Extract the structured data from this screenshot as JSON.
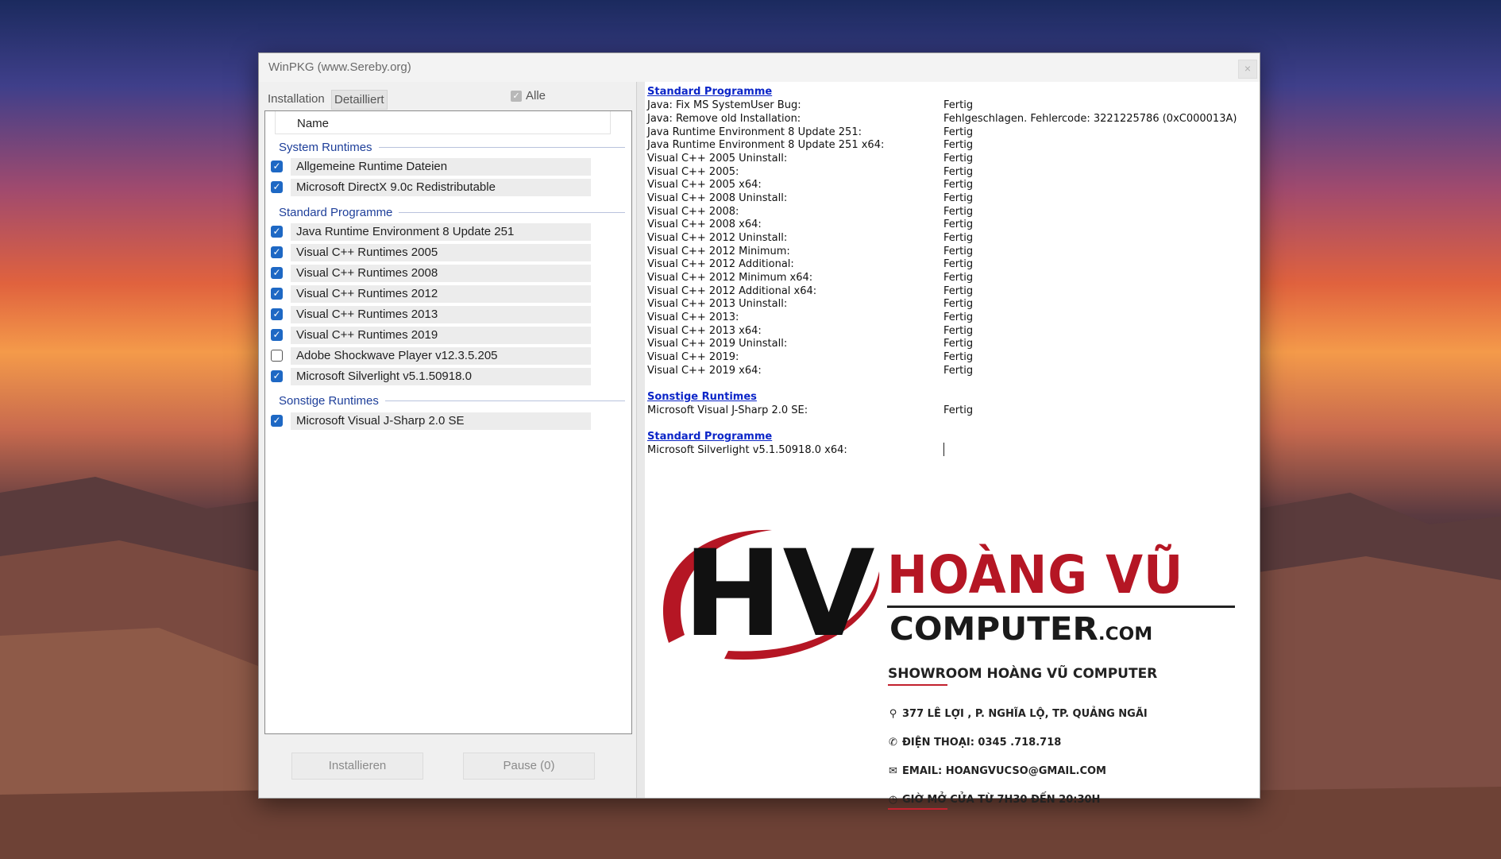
{
  "window": {
    "title": "WinPKG (www.Sereby.org)",
    "close_label": "×"
  },
  "tabs": {
    "installation": "Installation",
    "detailliert": "Detailliert"
  },
  "alle": {
    "label": "Alle",
    "checked": true
  },
  "list": {
    "column_header": "Name",
    "groups": [
      {
        "label": "System Runtimes",
        "items": [
          {
            "label": "Allgemeine Runtime Dateien",
            "checked": true
          },
          {
            "label": "Microsoft DirectX 9.0c Redistributable",
            "checked": true
          }
        ]
      },
      {
        "label": "Standard Programme",
        "items": [
          {
            "label": "Java Runtime Environment 8 Update 251",
            "checked": true
          },
          {
            "label": "Visual C++ Runtimes 2005",
            "checked": true
          },
          {
            "label": "Visual C++ Runtimes 2008",
            "checked": true
          },
          {
            "label": "Visual C++ Runtimes 2012",
            "checked": true
          },
          {
            "label": "Visual C++ Runtimes 2013",
            "checked": true
          },
          {
            "label": "Visual C++ Runtimes 2019",
            "checked": true
          },
          {
            "label": "Adobe Shockwave Player v12.3.5.205",
            "checked": false
          },
          {
            "label": "Microsoft Silverlight v5.1.50918.0",
            "checked": true
          }
        ]
      },
      {
        "label": "Sonstige Runtimes",
        "items": [
          {
            "label": "Microsoft Visual J-Sharp 2.0 SE",
            "checked": true
          }
        ]
      }
    ]
  },
  "buttons": {
    "install": "Installieren",
    "pause": "Pause (0)"
  },
  "log": {
    "sections": [
      {
        "heading": "Standard Programme",
        "entries": [
          {
            "name": "Java: Fix MS SystemUser Bug:",
            "status": "Fertig"
          },
          {
            "name": "Java: Remove old Installation:",
            "status": "Fehlgeschlagen. Fehlercode: 3221225786 (0xC000013A)"
          },
          {
            "name": "Java Runtime Environment 8 Update 251:",
            "status": "Fertig"
          },
          {
            "name": "Java Runtime Environment 8 Update 251 x64:",
            "status": "Fertig"
          },
          {
            "name": "Visual C++ 2005 Uninstall:",
            "status": "Fertig"
          },
          {
            "name": "Visual C++ 2005:",
            "status": "Fertig"
          },
          {
            "name": "Visual C++ 2005 x64:",
            "status": "Fertig"
          },
          {
            "name": "Visual C++ 2008 Uninstall:",
            "status": "Fertig"
          },
          {
            "name": "Visual C++ 2008:",
            "status": "Fertig"
          },
          {
            "name": "Visual C++ 2008 x64:",
            "status": "Fertig"
          },
          {
            "name": "Visual C++ 2012 Uninstall:",
            "status": "Fertig"
          },
          {
            "name": "Visual C++ 2012 Minimum:",
            "status": "Fertig"
          },
          {
            "name": "Visual C++ 2012 Additional:",
            "status": "Fertig"
          },
          {
            "name": "Visual C++ 2012 Minimum x64:",
            "status": "Fertig"
          },
          {
            "name": "Visual C++ 2012 Additional x64:",
            "status": "Fertig"
          },
          {
            "name": "Visual C++ 2013 Uninstall:",
            "status": "Fertig"
          },
          {
            "name": "Visual C++ 2013:",
            "status": "Fertig"
          },
          {
            "name": "Visual C++ 2013 x64:",
            "status": "Fertig"
          },
          {
            "name": "Visual C++ 2019 Uninstall:",
            "status": "Fertig"
          },
          {
            "name": "Visual C++ 2019:",
            "status": "Fertig"
          },
          {
            "name": "Visual C++ 2019 x64:",
            "status": "Fertig"
          }
        ]
      },
      {
        "heading": "Sonstige Runtimes",
        "entries": [
          {
            "name": "Microsoft Visual J-Sharp 2.0 SE:",
            "status": "Fertig"
          }
        ]
      },
      {
        "heading": "Standard Programme",
        "entries": [
          {
            "name": "Microsoft Silverlight v5.1.50918.0 x64:",
            "status": ""
          }
        ]
      }
    ]
  },
  "watermark": {
    "logo_letters": "HV",
    "name": "HOÀNG VŨ",
    "domain_main": "COMPUTER",
    "domain_suffix": ".COM",
    "showroom": "SHOWROOM HOÀNG VŨ COMPUTER",
    "address": "377 LÊ LỢI , P. NGHĨA LỘ, TP. QUẢNG NGÃI",
    "phone": "ĐIỆN THOẠI: 0345 .718.718",
    "email": "EMAIL: HOANGVUCSO@GMAIL.COM",
    "hours": "GIỜ MỞ CỬA TỪ 7H30 ĐẾN 20:30H",
    "icons": [
      "map-pin-icon",
      "phone-icon",
      "envelope-icon",
      "clock-icon"
    ],
    "colors": {
      "red": "#b51624",
      "dark": "#1a1a1a"
    }
  },
  "colors": {
    "accent": "#1e68c4",
    "group_text": "#1e3f9a",
    "log_heading": "#0c26c8"
  }
}
